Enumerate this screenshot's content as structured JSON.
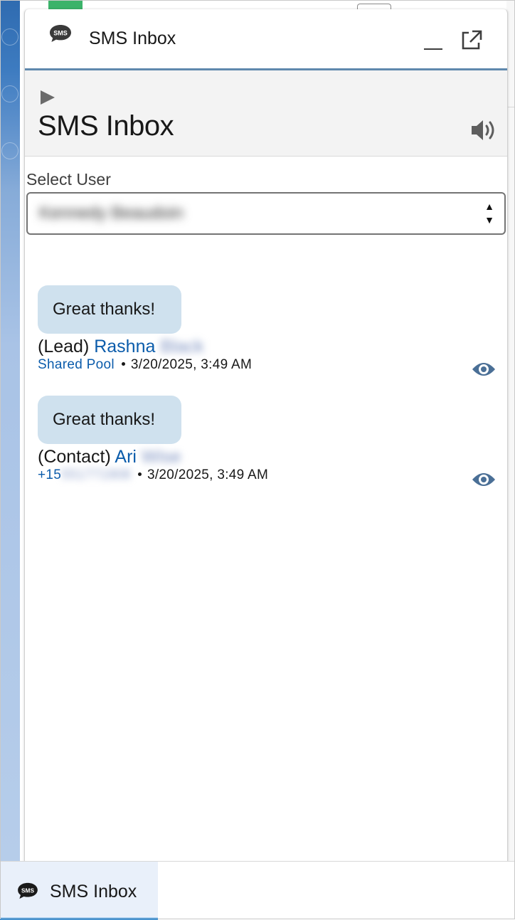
{
  "header": {
    "icon": "sms-chat-icon",
    "title": "SMS Inbox",
    "minimize_icon": "minimize-icon",
    "popout_icon": "popout-icon"
  },
  "subheader": {
    "play_icon": "play-icon",
    "title": "SMS Inbox",
    "sound_icon": "speaker-icon"
  },
  "user_select": {
    "label": "Select User",
    "value": "Kennedy Beaudoin",
    "arrow_up": "▲",
    "arrow_down": "▼"
  },
  "messages": [
    {
      "text": "Great thanks!",
      "record_type": "(Lead)",
      "first_name": "Rashna",
      "last_name_redacted": "Black",
      "source": "Shared Pool",
      "timestamp": "3/20/2025, 3:49 AM",
      "view_icon": "eye-icon"
    },
    {
      "text": "Great thanks!",
      "record_type": "(Contact)",
      "first_name": "Ari",
      "last_name_redacted": "Wise",
      "source_prefix": "+15",
      "source_redacted": "551771908",
      "timestamp": "3/20/2025, 3:49 AM",
      "view_icon": "eye-icon"
    }
  ],
  "utility_bar": {
    "tab_icon": "sms-chat-icon",
    "tab_label": "SMS Inbox"
  },
  "colors": {
    "link": "#0b5cab",
    "bubble": "#cfe1ee",
    "header_rule": "#5f88ad",
    "eye_icon": "#4a6f96"
  }
}
